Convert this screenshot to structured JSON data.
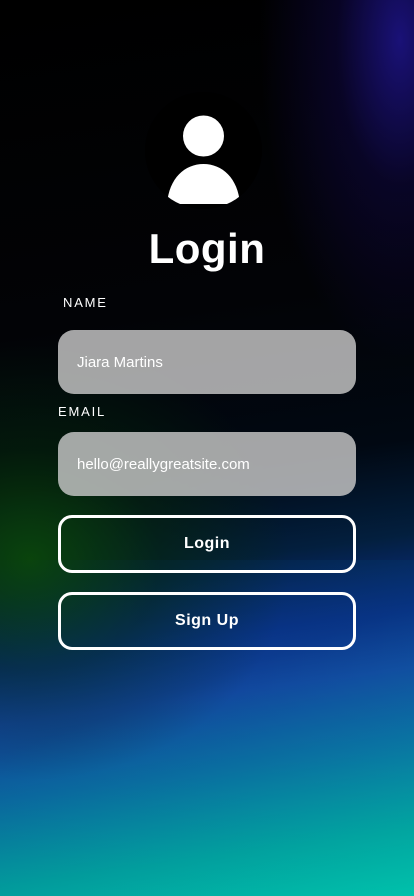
{
  "screen": {
    "title": "Login"
  },
  "avatar": {
    "icon": "user-avatar-icon"
  },
  "form": {
    "name": {
      "label": "NAME",
      "value": "Jiara Martins",
      "placeholder": ""
    },
    "email": {
      "label": "EMAIL",
      "value": "hello@reallygreatsite.com",
      "placeholder": ""
    }
  },
  "buttons": {
    "login": "Login",
    "signup": "Sign Up"
  },
  "colors": {
    "background_top": "#000000",
    "background_bottom": "#00d4b4",
    "accent_blue": "#1a49b6",
    "input_fill": "#c8c8c8",
    "text": "#ffffff"
  }
}
